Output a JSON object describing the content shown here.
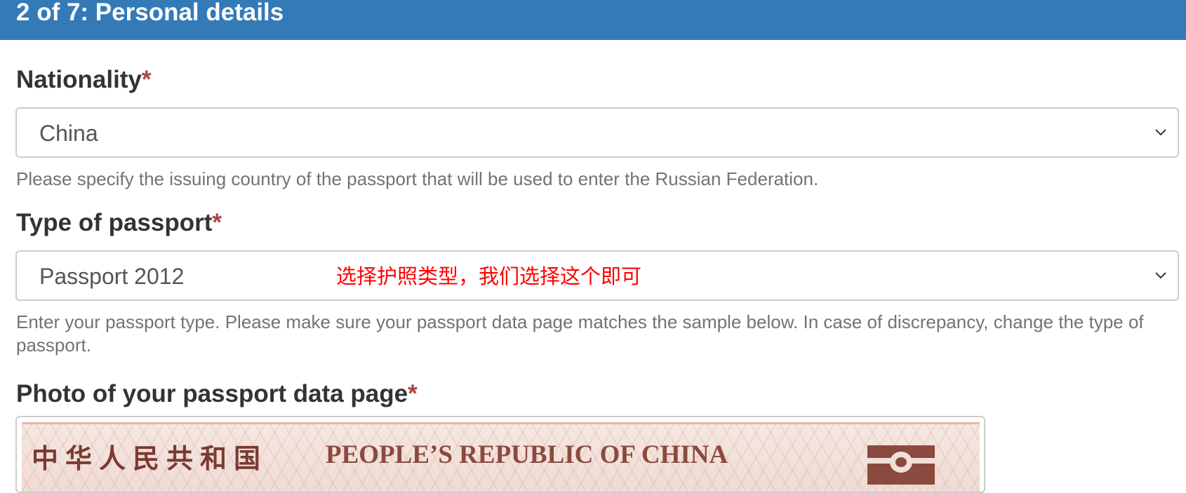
{
  "header": {
    "title": "2 of 7: Personal details"
  },
  "nationality": {
    "label": "Nationality",
    "required_mark": "*",
    "selected": "China",
    "help": "Please specify the issuing country of the passport that will be used to enter the Russian Federation."
  },
  "passport_type": {
    "label": "Type of passport",
    "required_mark": "*",
    "selected": "Passport 2012",
    "annotation": "选择护照类型，我们选择这个即可",
    "help": "Enter your passport type. Please make sure your passport data page matches the sample below. In case of discrepancy, change the type of passport."
  },
  "photo": {
    "label": "Photo of your passport data page",
    "required_mark": "*",
    "sample_cn": "中华人民共和国",
    "sample_en": "PEOPLE’S REPUBLIC OF CHINA"
  },
  "colors": {
    "header_bg": "#337ab7",
    "required": "#a94442",
    "annotation": "#ff0000"
  }
}
